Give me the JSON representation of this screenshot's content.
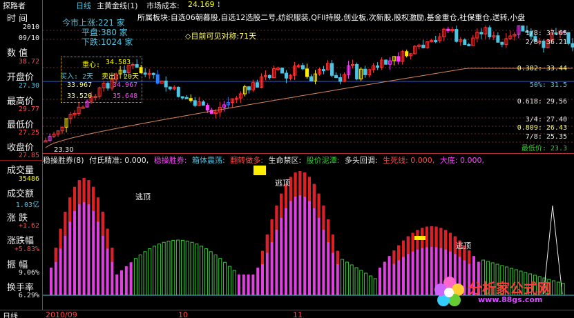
{
  "top_bar": {
    "app": "探路者",
    "period": "日线",
    "indicator": "主黄金线(1)",
    "cost_label": "市场成本:",
    "cost_value": "24.169",
    "cost_suffix": "⁞"
  },
  "left_panel": {
    "time_label": "时 间",
    "year": "2010",
    "date": "09/10",
    "value_label": "数 值",
    "value": "38.72",
    "open_label": "开盘价",
    "open": "27.30",
    "high_label": "最高价",
    "high": "29.77",
    "low_label": "最低价",
    "low": "27.25",
    "close_label": "收盘价",
    "close": "27.85",
    "volume_label": "成交量",
    "volume": "35486",
    "amount_label": "成交额",
    "amount": "1.03亿",
    "change_label": "涨 跌",
    "change": "+1.62",
    "pct_label": "涨跌幅",
    "pct": "+5.83%",
    "amp_label": "振 幅",
    "amp": "9.06%",
    "turnover_label": "换手率",
    "turnover": "6.29%",
    "colors": {
      "red": "#ff4a4a",
      "cyan": "#4fc3e0",
      "yellow": "#ffff00",
      "white": "#eeeeee"
    }
  },
  "sector": "所属板块:自选06朝暮股,自选12选股二号,纺织服装,QFII持股,创业板,次新股,股权激励,基金重仓,社保重仓,送转,小盘",
  "market": {
    "up_label": "今市上涨:",
    "up_value": "221",
    "flat_label": "平盘:",
    "flat_value": "380",
    "down_label": "下跌:",
    "down_value": "1024",
    "unit": "家"
  },
  "note_text": "◇目前可见对称:71天",
  "target_box": {
    "pressure_label": "重心:",
    "pressure_value": "34.583",
    "buy_label": "买入:",
    "buy_value": "2天",
    "sell_label": "卖出:",
    "sell_value": "20天",
    "r1_left": "33.967",
    "r1_right": "34.967",
    "r2_left": "33.520",
    "r2_right": "35.648"
  },
  "price_tag_low": "23.30",
  "fib_levels": [
    {
      "label": "1/8:",
      "value": "37.65"
    },
    {
      "label": "2/8:",
      "value": "36.21"
    },
    {
      "label": "",
      "value": "0.382: 33.44"
    },
    {
      "label": "",
      "value": "50%: 31.5"
    },
    {
      "label": "",
      "value": "0.618: 29.56"
    },
    {
      "label": "3/4:",
      "value": "27.40"
    },
    {
      "label": "",
      "value": "0.809: 26.43"
    },
    {
      "label": "7/8:",
      "value": "25.35"
    },
    {
      "label": "最低价:",
      "value": "23.3"
    }
  ],
  "indicator_header": [
    {
      "text": "稳操胜券(8)",
      "color": "#eeeeee"
    },
    {
      "text": "付氏精准: 0.000,",
      "color": "#eeeeee"
    },
    {
      "text": "稳操胜券:",
      "color": "#ff44ff"
    },
    {
      "text": "箱体震荡:",
      "color": "#4fc3e0"
    },
    {
      "text": "翻转做多:",
      "color": "#ff4a4a"
    },
    {
      "text": "生命禁区:",
      "color": "#eeeeee"
    },
    {
      "text": "股价泥潭:",
      "color": "#32d232"
    },
    {
      "text": "多头回调:",
      "color": "#eeeeee"
    },
    {
      "text": "生死线: 0.000,",
      "color": "#ff4a4a"
    },
    {
      "text": "大底: 0.000,",
      "color": "#ff44ff"
    }
  ],
  "escape_label": "逃顶",
  "date_axis": {
    "period": "日线",
    "d1": "2010/09",
    "d2": "10",
    "d3": "11"
  },
  "logo": {
    "brand": "分析家公式网",
    "url": "www.88gs.com"
  }
}
